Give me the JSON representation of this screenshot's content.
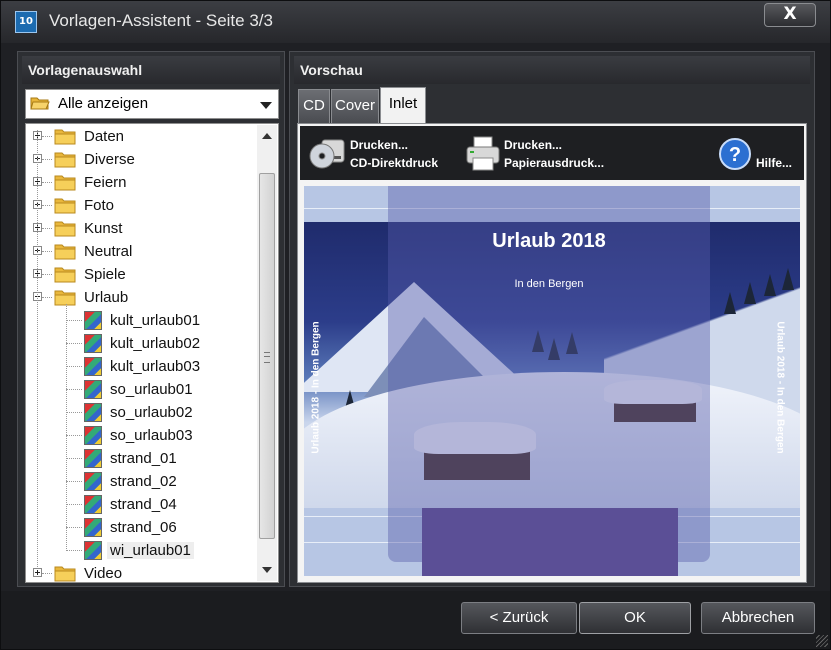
{
  "window": {
    "title": "Vorlagen-Assistent - Seite 3/3",
    "app_icon_text": "10",
    "close_label": "X"
  },
  "left_panel": {
    "header": "Vorlagenauswahl",
    "filter": {
      "selected": "Alle anzeigen",
      "icon": "folder-open-icon"
    },
    "tree": [
      {
        "label": "Daten",
        "type": "folder",
        "expanded": false
      },
      {
        "label": "Diverse",
        "type": "folder",
        "expanded": false
      },
      {
        "label": "Feiern",
        "type": "folder",
        "expanded": false
      },
      {
        "label": "Foto",
        "type": "folder",
        "expanded": false
      },
      {
        "label": "Kunst",
        "type": "folder",
        "expanded": false
      },
      {
        "label": "Neutral",
        "type": "folder",
        "expanded": false
      },
      {
        "label": "Spiele",
        "type": "folder",
        "expanded": false
      },
      {
        "label": "Urlaub",
        "type": "folder",
        "expanded": true
      },
      {
        "label": "kult_urlaub01",
        "type": "template"
      },
      {
        "label": "kult_urlaub02",
        "type": "template"
      },
      {
        "label": "kult_urlaub03",
        "type": "template"
      },
      {
        "label": "so_urlaub01",
        "type": "template"
      },
      {
        "label": "so_urlaub02",
        "type": "template"
      },
      {
        "label": "so_urlaub03",
        "type": "template"
      },
      {
        "label": "strand_01",
        "type": "template"
      },
      {
        "label": "strand_02",
        "type": "template"
      },
      {
        "label": "strand_04",
        "type": "template"
      },
      {
        "label": "strand_06",
        "type": "template"
      },
      {
        "label": "wi_urlaub01",
        "type": "template",
        "selected": true
      },
      {
        "label": "Video",
        "type": "folder",
        "expanded": false
      }
    ]
  },
  "right_panel": {
    "header": "Vorschau",
    "tabs": [
      {
        "label": "CD",
        "active": false
      },
      {
        "label": "Cover",
        "active": false
      },
      {
        "label": "Inlet",
        "active": true
      }
    ],
    "toolbar": {
      "print_cd": {
        "line1": "Drucken...",
        "line2": "CD-Direktdruck",
        "icon": "cd-printer-icon"
      },
      "print_paper": {
        "line1": "Drucken...",
        "line2": "Papierausdruck...",
        "icon": "printer-icon"
      },
      "help": {
        "label": "Hilfe...",
        "icon": "help-icon"
      }
    },
    "preview": {
      "title": "Urlaub 2018",
      "subtitle": "In den Bergen",
      "spine_text": "Urlaub 2018 - In den Bergen"
    }
  },
  "buttons": {
    "back": "< Zurück",
    "ok": "OK",
    "cancel": "Abbrechen"
  },
  "colors": {
    "window_bg": "#1f2024",
    "accent_overlay": "#5b4f96",
    "preview_band": "#b7c6e4"
  }
}
